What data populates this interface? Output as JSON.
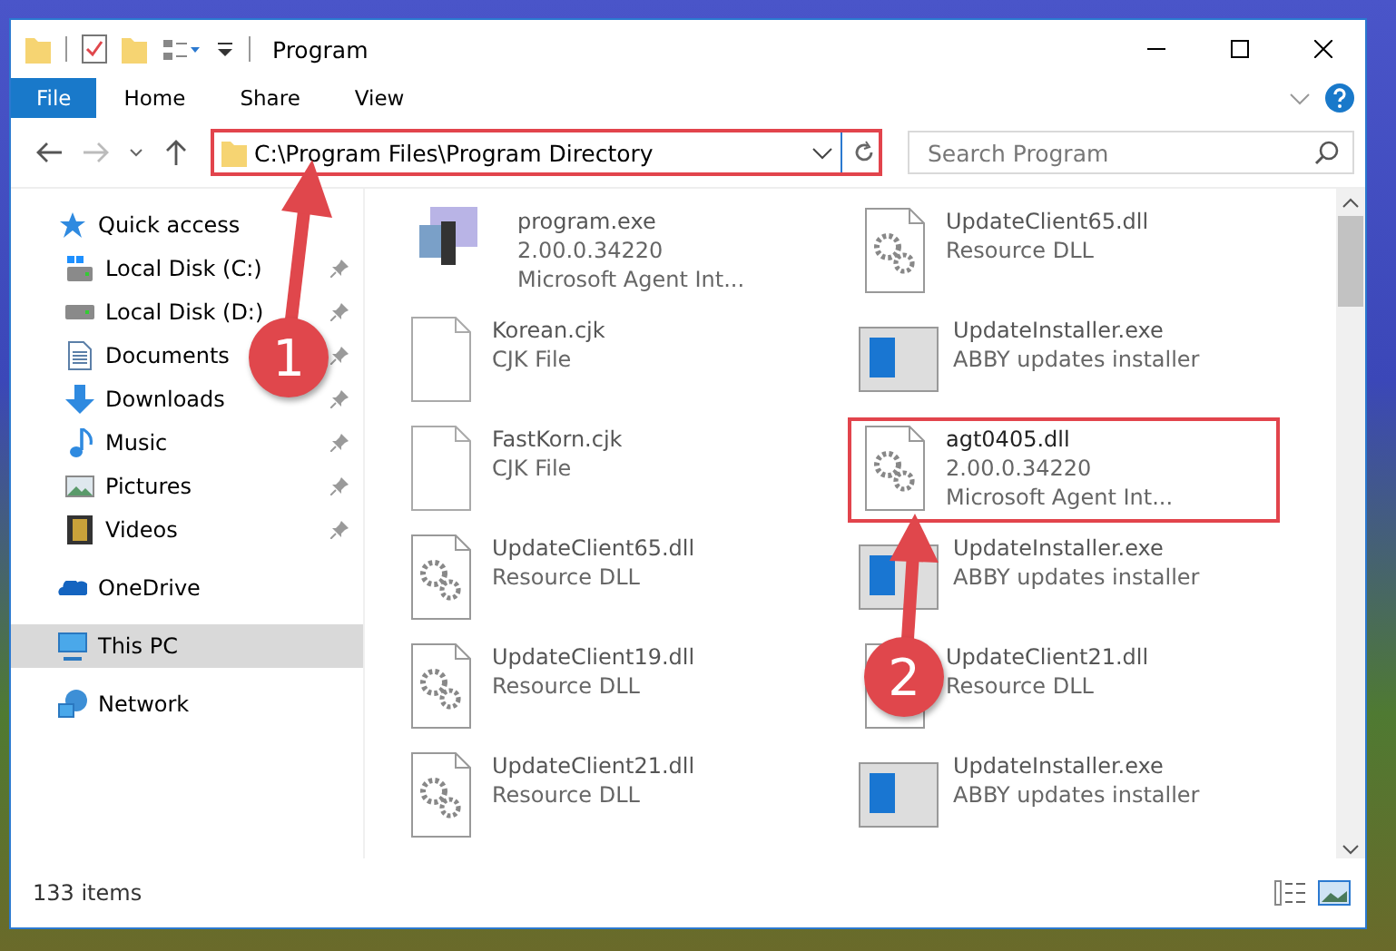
{
  "window": {
    "title": "Program"
  },
  "ribbon_tabs": [
    {
      "label": "File",
      "kind": "file"
    },
    {
      "label": "Home",
      "kind": "tab"
    },
    {
      "label": "Share",
      "kind": "tab"
    },
    {
      "label": "View",
      "kind": "tab"
    }
  ],
  "address": {
    "value": "C:\\Program Files\\Program Directory"
  },
  "search": {
    "placeholder": "Search Program"
  },
  "sidebar": {
    "items": [
      {
        "label": "Quick access",
        "kind": "star",
        "selected": false,
        "children": [
          {
            "label": "Local Disk (C:)",
            "kind": "system-drive",
            "pinned": true,
            "selected": false
          },
          {
            "label": "Local Disk (D:)",
            "kind": "drive",
            "pinned": true,
            "selected": false
          },
          {
            "label": "Documents",
            "kind": "document",
            "pinned": true,
            "selected": false
          },
          {
            "label": "Downloads",
            "kind": "download",
            "pinned": true,
            "selected": false
          },
          {
            "label": "Music",
            "kind": "music",
            "pinned": true,
            "selected": false
          },
          {
            "label": "Pictures",
            "kind": "pictures",
            "pinned": true,
            "selected": false
          },
          {
            "label": "Videos",
            "kind": "videos",
            "pinned": true,
            "selected": false
          }
        ]
      },
      {
        "label": "OneDrive",
        "kind": "cloud",
        "selected": false
      },
      {
        "label": "This PC",
        "kind": "pc",
        "selected": true
      },
      {
        "label": "Network",
        "kind": "network",
        "selected": false
      }
    ]
  },
  "files": [
    {
      "name": "program.exe",
      "details": [
        "2.00.0.34220",
        "Microsoft Agent Int..."
      ],
      "kind": "program",
      "highlighted": false
    },
    {
      "name": "UpdateClient65.dll",
      "details": [
        "Resource DLL"
      ],
      "kind": "dll",
      "highlighted": false
    },
    {
      "name": "Korean.cjk",
      "details": [
        "CJK File"
      ],
      "kind": "blank",
      "highlighted": false
    },
    {
      "name": "UpdateInstaller.exe",
      "details": [
        "ABBY updates installer"
      ],
      "kind": "installer",
      "highlighted": false
    },
    {
      "name": "FastKorn.cjk",
      "details": [
        "CJK File"
      ],
      "kind": "blank",
      "highlighted": false
    },
    {
      "name": "agt0405.dll",
      "details": [
        "2.00.0.34220",
        "Microsoft Agent Int..."
      ],
      "kind": "dll",
      "highlighted": true
    },
    {
      "name": "UpdateClient65.dll",
      "details": [
        "Resource DLL"
      ],
      "kind": "dll",
      "highlighted": false
    },
    {
      "name": "UpdateInstaller.exe",
      "details": [
        "ABBY updates installer"
      ],
      "kind": "installer",
      "highlighted": false
    },
    {
      "name": "UpdateClient19.dll",
      "details": [
        "Resource DLL"
      ],
      "kind": "dll",
      "highlighted": false
    },
    {
      "name": "UpdateClient21.dll",
      "details": [
        "Resource DLL"
      ],
      "kind": "dll",
      "highlighted": false
    },
    {
      "name": "UpdateClient21.dll",
      "details": [
        "Resource DLL"
      ],
      "kind": "dll",
      "highlighted": false
    },
    {
      "name": "UpdateInstaller.exe",
      "details": [
        "ABBY updates installer"
      ],
      "kind": "installer",
      "highlighted": false
    }
  ],
  "status_bar": {
    "count": "133 items"
  },
  "annotations": [
    {
      "number": "1"
    },
    {
      "number": "2"
    }
  ]
}
